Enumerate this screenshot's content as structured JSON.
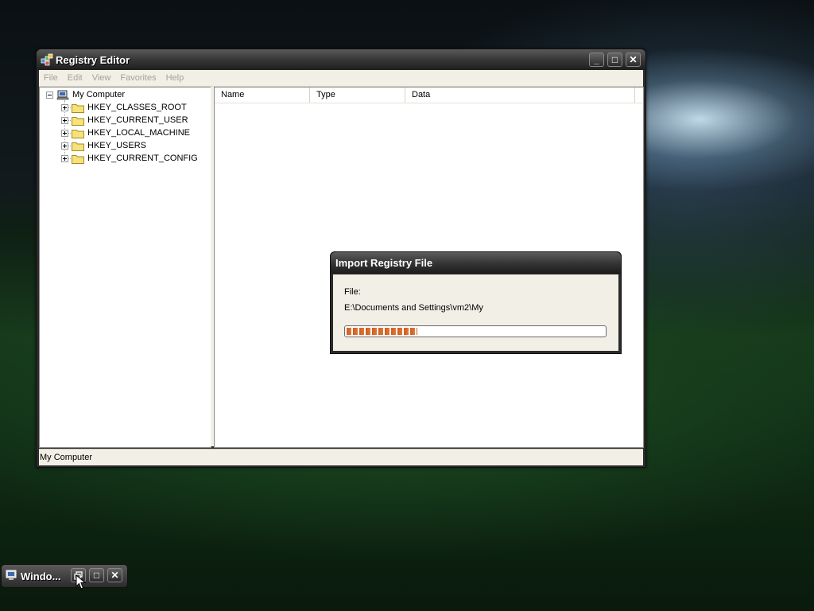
{
  "window": {
    "title": "Registry Editor",
    "minimize_glyph": "_",
    "maximize_glyph": "□",
    "close_glyph": "✕"
  },
  "menu": {
    "items": [
      "File",
      "Edit",
      "View",
      "Favorites",
      "Help"
    ]
  },
  "tree": {
    "root": "My Computer",
    "keys": [
      "HKEY_CLASSES_ROOT",
      "HKEY_CURRENT_USER",
      "HKEY_LOCAL_MACHINE",
      "HKEY_USERS",
      "HKEY_CURRENT_CONFIG"
    ]
  },
  "list": {
    "columns": [
      "Name",
      "Type",
      "Data"
    ]
  },
  "status": {
    "text": "My Computer"
  },
  "dialog": {
    "title": "Import Registry File",
    "file_label": "File:",
    "file_path": "E:\\Documents and Settings\\vm2\\My",
    "progress": 0.27
  },
  "minimized_window": {
    "title": "Windo..."
  },
  "icons": {
    "app": "registry-editor-icon",
    "computer": "computer-icon",
    "folder": "folder-icon",
    "restore": "restore-icon",
    "cursor": "mouse-cursor-icon"
  },
  "colors": {
    "progress": "#d05a1c",
    "folder": "#f5e27a"
  }
}
